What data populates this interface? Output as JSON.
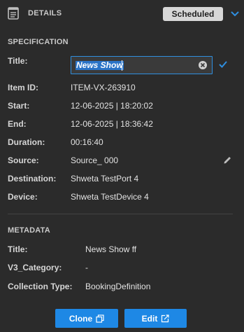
{
  "header": {
    "title": "DETAILS",
    "status": "Scheduled",
    "icons": [
      "document-icon",
      "chevron-down-icon"
    ]
  },
  "specification": {
    "section_title": "SPECIFICATION",
    "title_label": "Title:",
    "title_value": "News Show",
    "fields": [
      {
        "label": "Item ID:",
        "value": "ITEM-VX-263910"
      },
      {
        "label": "Start:",
        "value": "12-06-2025 | 18:20:02"
      },
      {
        "label": "End:",
        "value": "12-06-2025 | 18:36:42"
      },
      {
        "label": "Duration:",
        "value": "00:16:40"
      },
      {
        "label": "Source:",
        "value": "Source_ 000"
      },
      {
        "label": "Destination:",
        "value": "Shweta TestPort 4"
      },
      {
        "label": "Device:",
        "value": "Shweta TestDevice 4"
      }
    ]
  },
  "metadata": {
    "section_title": "METADATA",
    "fields": [
      {
        "label": "Title:",
        "value": "News Show ff"
      },
      {
        "label": "V3_Category:",
        "value": "-"
      },
      {
        "label": "Collection Type:",
        "value": "BookingDefinition"
      }
    ]
  },
  "actions": {
    "clone_label": "Clone",
    "edit_label": "Edit"
  },
  "colors": {
    "background": "#2b2b2b",
    "accent": "#1e88e5",
    "badge_bg": "#d7d7d7"
  }
}
